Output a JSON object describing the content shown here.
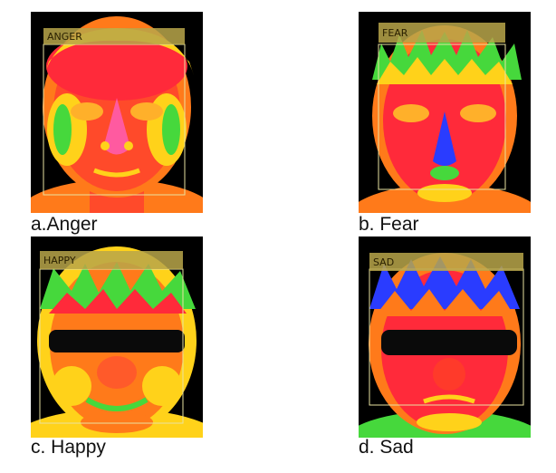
{
  "panels": [
    {
      "tag": "ANGER",
      "caption": "a.Anger"
    },
    {
      "tag": "FEAR",
      "caption": "b. Fear"
    },
    {
      "tag": "HAPPY",
      "caption": "c. Happy"
    },
    {
      "tag": "SAD",
      "caption": "d. Sad"
    }
  ],
  "colors": {
    "background": "#000000",
    "hot": "#ff2a3a",
    "warm": "#ff7a1a",
    "mid": "#ffd21a",
    "cool": "#46d83c",
    "cold": "#2a3cff",
    "box": "#e8e2a0",
    "tag_bar": "#b8a64a"
  }
}
